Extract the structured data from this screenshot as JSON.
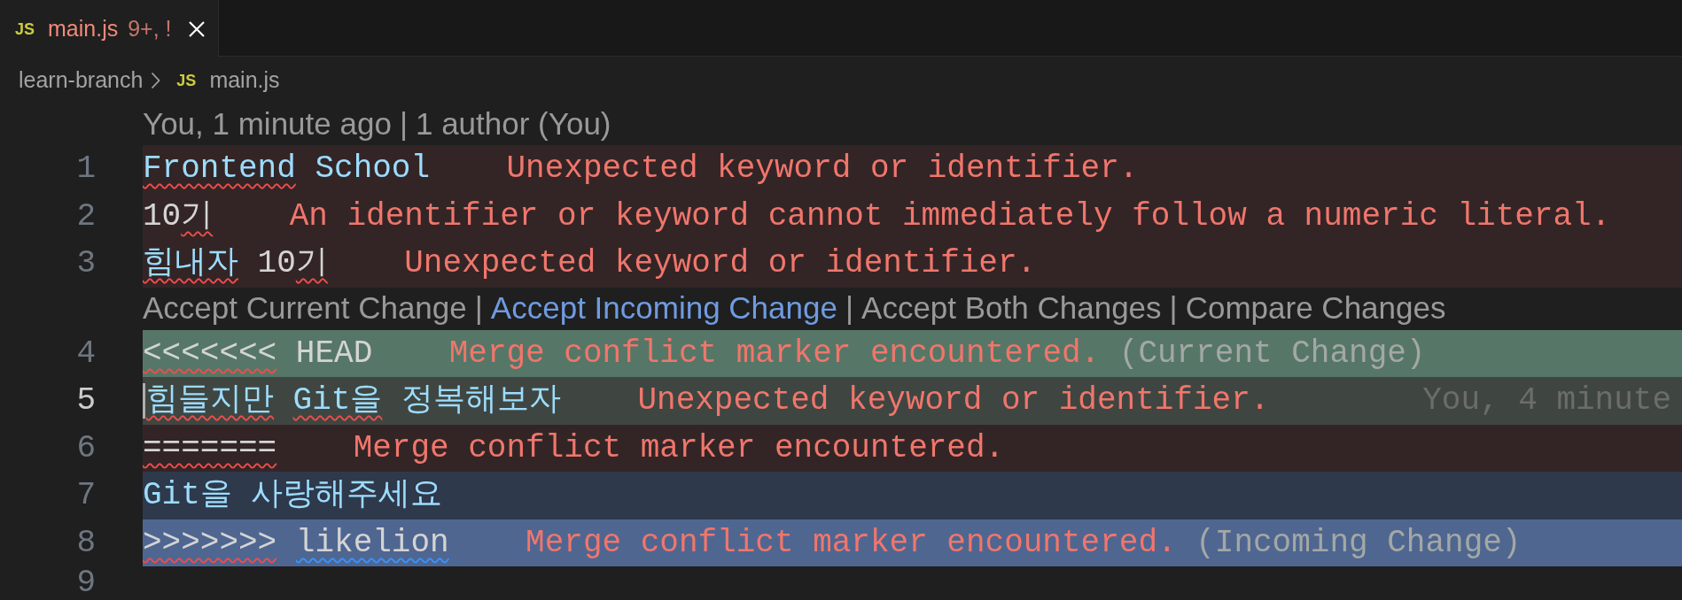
{
  "tabs": [
    {
      "icon": "JS",
      "label": "main.js",
      "decoration": "9+, !",
      "selected": true,
      "has_errors": true
    }
  ],
  "breadcrumb": [
    {
      "label": "learn-branch"
    },
    {
      "icon": "JS",
      "label": "main.js"
    }
  ],
  "editor": {
    "rows": [
      {
        "kind": "codelens",
        "separator": "|",
        "items": [
          {
            "label": "You, 1 minute ago",
            "hovered": false
          },
          {
            "label": "1 author (You)",
            "hovered": false
          }
        ]
      },
      {
        "kind": "error",
        "number": "1",
        "current": false,
        "tokens": [
          {
            "text": "Frontend",
            "kind": "identifier",
            "error": true
          },
          {
            "text": " School",
            "kind": "identifier",
            "error": false,
            "info": false
          }
        ],
        "message": "Unexpected keyword or identifier."
      },
      {
        "kind": "error",
        "number": "2",
        "current": false,
        "tokens": [
          {
            "text": "10",
            "kind": "plain",
            "error": false,
            "info": false
          },
          {
            "text": "기",
            "kind": "plain",
            "error": true
          }
        ],
        "message": "An identifier or keyword cannot immediately follow a numeric literal."
      },
      {
        "kind": "error",
        "number": "3",
        "current": false,
        "tokens": [
          {
            "text": "힘내자",
            "kind": "identifier",
            "error": true
          },
          {
            "text": " 10",
            "kind": "plain",
            "error": false,
            "info": false
          },
          {
            "text": "기",
            "kind": "plain",
            "error": true
          }
        ],
        "message": "Unexpected keyword or identifier."
      },
      {
        "kind": "codelens",
        "separator": "|",
        "items": [
          {
            "label": "Accept Current Change",
            "hovered": false
          },
          {
            "label": "Accept Incoming Change",
            "hovered": true
          },
          {
            "label": "Accept Both Changes",
            "hovered": false
          },
          {
            "label": "Compare Changes",
            "hovered": false
          }
        ]
      },
      {
        "kind": "current-marker",
        "number": "4",
        "current": false,
        "tokens": [
          {
            "text": "<<<<<<<",
            "kind": "plain",
            "error": true
          },
          {
            "text": " HEAD",
            "kind": "plain",
            "error": false,
            "info": false
          }
        ],
        "message": "Merge conflict marker encountered.",
        "note": "(Current Change)"
      },
      {
        "kind": "current",
        "number": "5",
        "current": true,
        "tokens": [
          {
            "text": "힘들지만 ",
            "kind": "identifier",
            "error": true
          },
          {
            "text": "Git을",
            "kind": "identifier",
            "error": true
          },
          {
            "text": " 정복해보자",
            "kind": "identifier",
            "error": false,
            "info": false
          }
        ],
        "message": "Unexpected keyword or identifier.",
        "blame": "You, 4 minute"
      },
      {
        "kind": "error",
        "number": "6",
        "current": false,
        "tokens": [
          {
            "text": "=======",
            "kind": "plain",
            "error": true
          }
        ],
        "message": "Merge conflict marker encountered."
      },
      {
        "kind": "incoming",
        "number": "7",
        "current": false,
        "tokens": [
          {
            "text": "Git을 사랑해주세요",
            "kind": "identifier",
            "error": false,
            "info": false
          }
        ]
      },
      {
        "kind": "incoming-marker",
        "number": "8",
        "current": false,
        "tokens": [
          {
            "text": ">>>>>>> ",
            "kind": "plain",
            "error": true
          },
          {
            "text": "likelion",
            "kind": "plain",
            "error": false,
            "info": true
          }
        ],
        "message": "Merge conflict marker encountered.",
        "note": "(Incoming Change)"
      },
      {
        "kind": "plain",
        "number": "9",
        "current": false
      }
    ]
  }
}
